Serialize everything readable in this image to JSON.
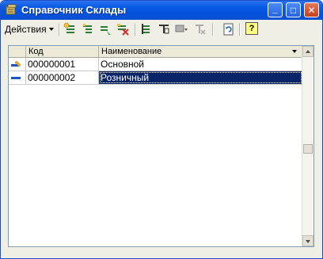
{
  "window": {
    "title": "Справочник Склады",
    "icon": "folder-catalog-icon"
  },
  "titlebar_buttons": {
    "minimize": "_",
    "maximize": "□",
    "close": "✕"
  },
  "toolbar": {
    "actions_label": "Действия",
    "icons": [
      "add-item-icon",
      "add-group-icon",
      "copy-item-icon",
      "mark-delete-icon",
      "hierarchy-filter-icon",
      "filter-icon",
      "filter-dropdown-icon",
      "clear-filter-icon",
      "refresh-icon",
      "help-icon"
    ],
    "help_label": "?"
  },
  "table": {
    "columns": [
      "Код",
      "Наименование"
    ],
    "rows": [
      {
        "code": "000000001",
        "name": "Основной",
        "icon": "item-pencil-icon"
      },
      {
        "code": "000000002",
        "name": "Розничный",
        "icon": "item-dash-icon"
      }
    ],
    "selected_row": 1
  },
  "colors": {
    "title_bar": "#0454e0",
    "selection": "#0a246a",
    "window_bg": "#f0efe6"
  }
}
